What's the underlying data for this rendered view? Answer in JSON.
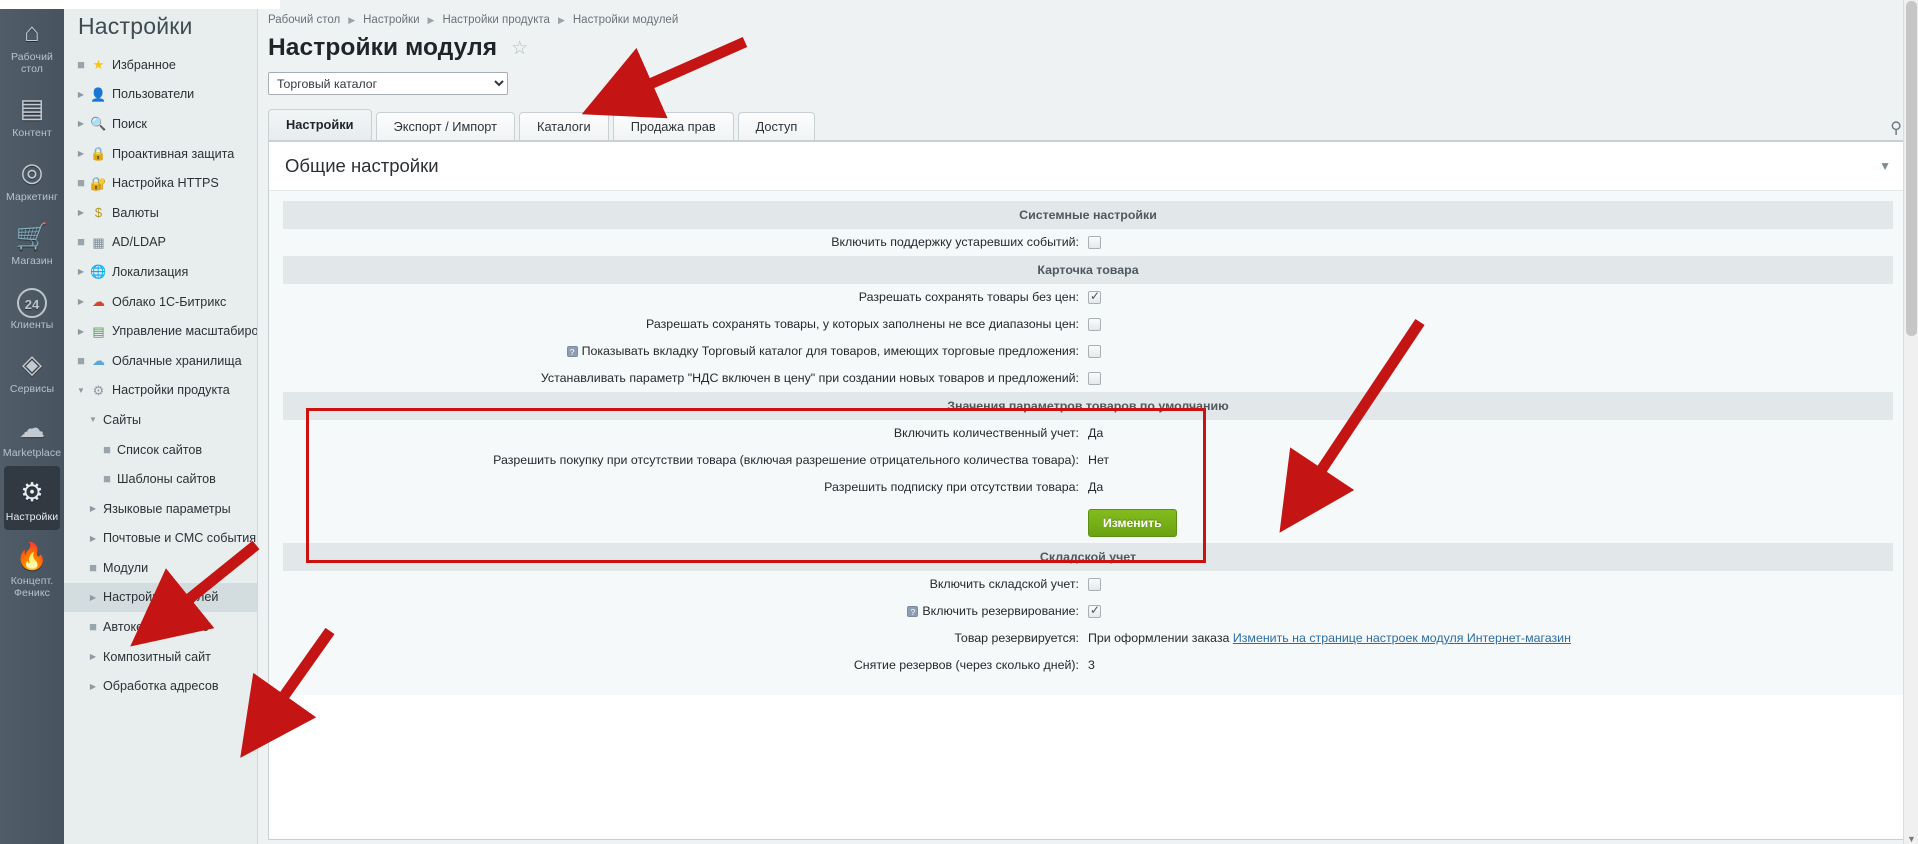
{
  "rail": {
    "items": [
      {
        "name": "desktop",
        "glyph": "⌂",
        "label": "Рабочий\nстол",
        "active": false
      },
      {
        "name": "content",
        "glyph": "▤",
        "label": "Контент",
        "active": false
      },
      {
        "name": "marketing",
        "glyph": "◎",
        "label": "Маркетинг",
        "active": false
      },
      {
        "name": "shop",
        "glyph": "🛒",
        "label": "Магазин",
        "active": false
      },
      {
        "name": "clients",
        "glyph": "24",
        "label": "Клиенты",
        "active": false
      },
      {
        "name": "services",
        "glyph": "◈",
        "label": "Сервисы",
        "active": false
      },
      {
        "name": "marketplace",
        "glyph": "☁",
        "label": "Marketplace",
        "active": false
      },
      {
        "name": "settings",
        "glyph": "⚙",
        "label": "Настройки",
        "active": true
      },
      {
        "name": "phoenix",
        "glyph": "🔥",
        "label": "Концепт.\nФеникс",
        "active": false
      }
    ]
  },
  "sidemenu": {
    "title": "Настройки",
    "items": [
      {
        "label": "Избранное",
        "icon": "★",
        "icon_color": "#f5c518",
        "twisty": "dot",
        "level": 1,
        "selected": false
      },
      {
        "label": "Пользователи",
        "icon": "👤",
        "icon_color": "#8a96a0",
        "twisty": "right",
        "level": 1,
        "selected": false
      },
      {
        "label": "Поиск",
        "icon": "🔍",
        "icon_color": "#6f8fae",
        "twisty": "right",
        "level": 1,
        "selected": false
      },
      {
        "label": "Проактивная защита",
        "icon": "🔒",
        "icon_color": "#e0a82e",
        "twisty": "right",
        "level": 1,
        "selected": false
      },
      {
        "label": "Настройка HTTPS",
        "icon": "🔐",
        "icon_color": "#2f7fc4",
        "twisty": "dot",
        "level": 1,
        "selected": false
      },
      {
        "label": "Валюты",
        "icon": "$",
        "icon_color": "#b79a22",
        "twisty": "right",
        "level": 1,
        "selected": false
      },
      {
        "label": "AD/LDAP",
        "icon": "▦",
        "icon_color": "#7d8b97",
        "twisty": "dot",
        "level": 1,
        "selected": false
      },
      {
        "label": "Локализация",
        "icon": "🌐",
        "icon_color": "#2f7fc4",
        "twisty": "right",
        "level": 1,
        "selected": false
      },
      {
        "label": "Облако 1С-Битрикс",
        "icon": "☁",
        "icon_color": "#d2452f",
        "twisty": "right",
        "level": 1,
        "selected": false
      },
      {
        "label": "Управление масштабирова",
        "icon": "▤",
        "icon_color": "#4f9b4f",
        "twisty": "right",
        "level": 1,
        "selected": false
      },
      {
        "label": "Облачные хранилища",
        "icon": "☁",
        "icon_color": "#5aa7d8",
        "twisty": "dot",
        "level": 1,
        "selected": false
      },
      {
        "label": "Настройки продукта",
        "icon": "⚙",
        "icon_color": "#8e9aa3",
        "twisty": "down",
        "level": 1,
        "selected": false
      },
      {
        "label": "Сайты",
        "icon": "",
        "icon_color": "",
        "twisty": "down",
        "level": 2,
        "selected": false
      },
      {
        "label": "Список сайтов",
        "icon": "",
        "icon_color": "",
        "twisty": "dot",
        "level": 3,
        "selected": false
      },
      {
        "label": "Шаблоны сайтов",
        "icon": "",
        "icon_color": "",
        "twisty": "dot",
        "level": 3,
        "selected": false
      },
      {
        "label": "Языковые параметры",
        "icon": "",
        "icon_color": "",
        "twisty": "right",
        "level": 2,
        "selected": false
      },
      {
        "label": "Почтовые и СМС события",
        "icon": "",
        "icon_color": "",
        "twisty": "right",
        "level": 2,
        "selected": false
      },
      {
        "label": "Модули",
        "icon": "",
        "icon_color": "",
        "twisty": "dot",
        "level": 2,
        "selected": false
      },
      {
        "label": "Настройки модулей",
        "icon": "",
        "icon_color": "",
        "twisty": "right",
        "level": 2,
        "selected": true
      },
      {
        "label": "Автокеширование",
        "icon": "",
        "icon_color": "",
        "twisty": "dot",
        "level": 2,
        "selected": false
      },
      {
        "label": "Композитный сайт",
        "icon": "",
        "icon_color": "",
        "twisty": "right",
        "level": 2,
        "selected": false
      },
      {
        "label": "Обработка адресов",
        "icon": "",
        "icon_color": "",
        "twisty": "right",
        "level": 2,
        "selected": false
      }
    ]
  },
  "breadcrumbs": [
    "Рабочий стол",
    "Настройки",
    "Настройки продукта",
    "Настройки модулей"
  ],
  "page": {
    "title": "Настройки модуля",
    "favorite_icon": "star-outline",
    "module_select_value": "Торговый каталог",
    "module_select_options": [
      "Торговый каталог"
    ],
    "pin_icon": "pin-icon"
  },
  "tabs": [
    {
      "label": "Настройки",
      "active": true
    },
    {
      "label": "Экспорт / Импорт",
      "active": false
    },
    {
      "label": "Каталоги",
      "active": false
    },
    {
      "label": "Продажа прав",
      "active": false
    },
    {
      "label": "Доступ",
      "active": false
    }
  ],
  "panel": {
    "heading": "Общие настройки",
    "collapse_icon": "chevron-down-icon"
  },
  "sections": [
    {
      "id": "system",
      "title": "Системные настройки",
      "rows": [
        {
          "label": "Включить поддержку устаревших событий:",
          "type": "checkbox",
          "checked": false,
          "help": false
        }
      ]
    },
    {
      "id": "product-card",
      "title": "Карточка товара",
      "rows": [
        {
          "label": "Разрешать сохранять товары без цен:",
          "type": "checkbox",
          "checked": true,
          "help": false
        },
        {
          "label": "Разрешать сохранять товары, у которых заполнены не все диапазоны цен:",
          "type": "checkbox",
          "checked": false,
          "help": false
        },
        {
          "label": "Показывать вкладку Торговый каталог для товаров, имеющих торговые предложения:",
          "type": "checkbox",
          "checked": false,
          "help": true
        },
        {
          "label": "Устанавливать параметр \"НДС включен в цену\" при создании новых товаров и предложений:",
          "type": "checkbox",
          "checked": false,
          "help": false
        }
      ]
    },
    {
      "id": "defaults",
      "title": "Значения параметров товаров по умолчанию",
      "highlighted": true,
      "rows": [
        {
          "label": "Включить количественный учет:",
          "type": "text",
          "value": "Да",
          "help": false
        },
        {
          "label": "Разрешить покупку при отсутствии товара (включая разрешение отрицательного количества товара):",
          "type": "text",
          "value": "Нет",
          "help": false
        },
        {
          "label": "Разрешить подписку при отсутствии товара:",
          "type": "text",
          "value": "Да",
          "help": false
        }
      ],
      "button": "Изменить"
    },
    {
      "id": "warehouse",
      "title": "Складской учет",
      "rows": [
        {
          "label": "Включить складской учет:",
          "type": "checkbox",
          "checked": false,
          "help": false
        },
        {
          "label": "Включить резервирование:",
          "type": "checkbox",
          "checked": true,
          "help": true
        },
        {
          "label": "Товар резервируется:",
          "type": "text-link",
          "value": "При оформлении заказа",
          "link": "Изменить на странице настроек модуля Интернет-магазин",
          "help": false
        },
        {
          "label": "Снятие резервов (через сколько дней):",
          "type": "text",
          "value": "3",
          "help": false
        }
      ]
    }
  ],
  "annotations": {
    "arrow_color": "#c41414",
    "arrows": [
      {
        "name": "arrow-to-module-select"
      },
      {
        "name": "arrow-to-defaults-section"
      },
      {
        "name": "arrow-to-site-list"
      },
      {
        "name": "arrow-to-module-settings"
      }
    ],
    "highlight_color": "#cc1111"
  }
}
